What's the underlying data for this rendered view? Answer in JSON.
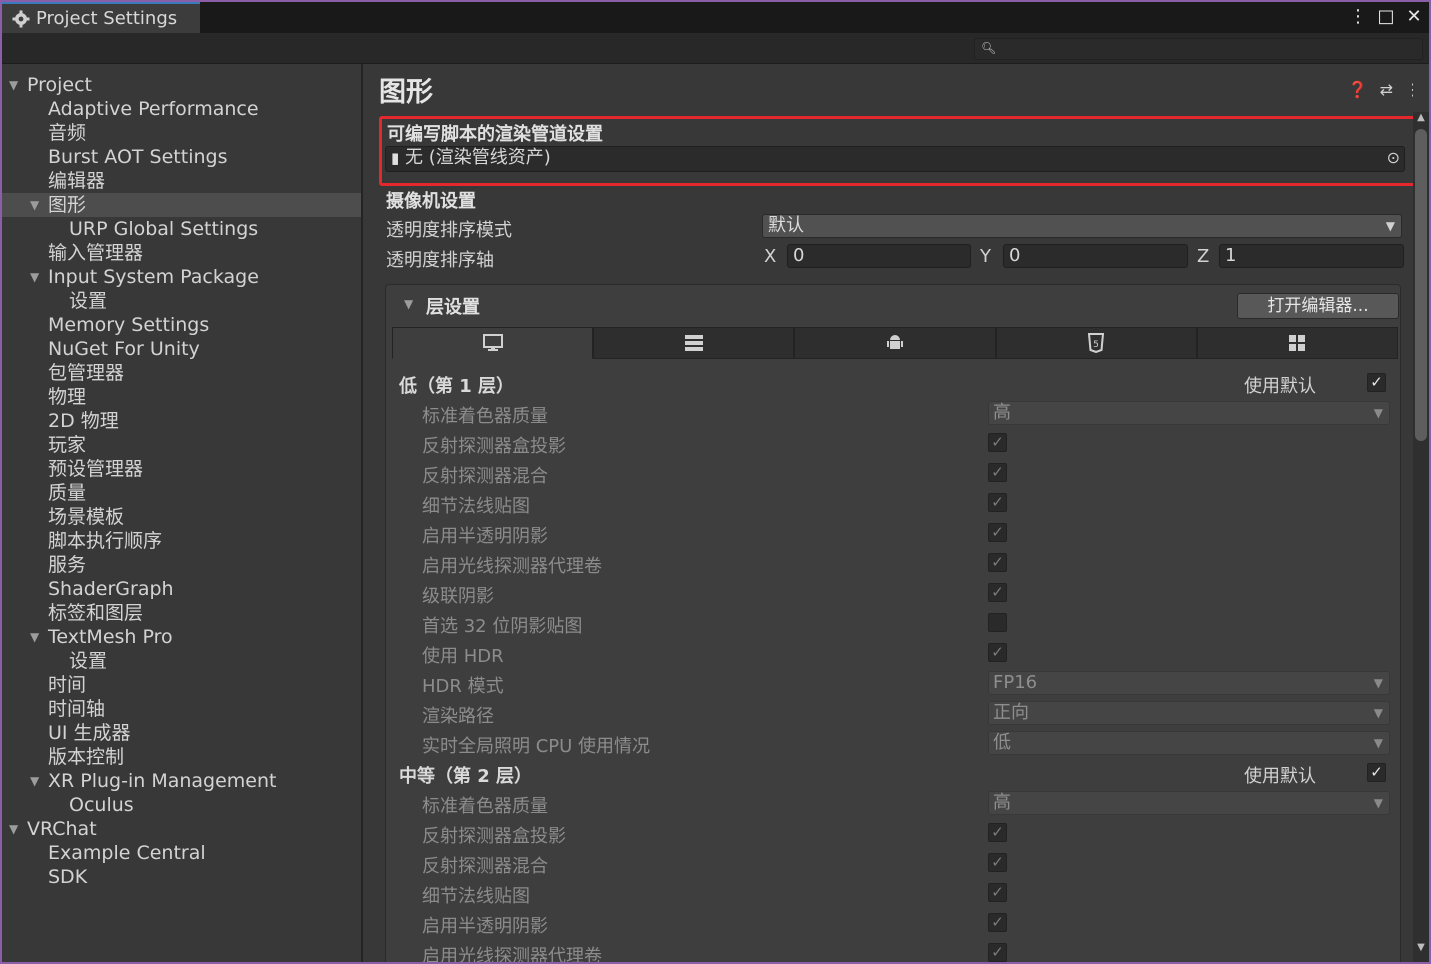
{
  "window": {
    "tab_title": "Project Settings",
    "controls": [
      "⋮",
      "□",
      "✕"
    ]
  },
  "search": {
    "value": ""
  },
  "sidebar": {
    "items": [
      {
        "label": "Project",
        "level": 0,
        "expand": true
      },
      {
        "label": "Adaptive Performance",
        "level": 1
      },
      {
        "label": "音频",
        "level": 1
      },
      {
        "label": "Burst AOT Settings",
        "level": 1
      },
      {
        "label": "编辑器",
        "level": 1
      },
      {
        "label": "图形",
        "level": 1,
        "expand": true,
        "selected": true
      },
      {
        "label": "URP Global Settings",
        "level": 2
      },
      {
        "label": "输入管理器",
        "level": 1
      },
      {
        "label": "Input System Package",
        "level": 1,
        "expand": true
      },
      {
        "label": "设置",
        "level": 2
      },
      {
        "label": "Memory Settings",
        "level": 1
      },
      {
        "label": "NuGet For Unity",
        "level": 1
      },
      {
        "label": "包管理器",
        "level": 1
      },
      {
        "label": "物理",
        "level": 1
      },
      {
        "label": "2D 物理",
        "level": 1
      },
      {
        "label": "玩家",
        "level": 1
      },
      {
        "label": "预设管理器",
        "level": 1
      },
      {
        "label": "质量",
        "level": 1
      },
      {
        "label": "场景模板",
        "level": 1
      },
      {
        "label": "脚本执行顺序",
        "level": 1
      },
      {
        "label": "服务",
        "level": 1
      },
      {
        "label": "ShaderGraph",
        "level": 1
      },
      {
        "label": "标签和图层",
        "level": 1
      },
      {
        "label": "TextMesh Pro",
        "level": 1,
        "expand": true
      },
      {
        "label": "设置",
        "level": 2
      },
      {
        "label": "时间",
        "level": 1
      },
      {
        "label": "时间轴",
        "level": 1
      },
      {
        "label": "UI 生成器",
        "level": 1
      },
      {
        "label": "版本控制",
        "level": 1
      },
      {
        "label": "XR Plug-in Management",
        "level": 1,
        "expand": true
      },
      {
        "label": "Oculus",
        "level": 2
      },
      {
        "label": "VRChat",
        "level": 0,
        "expand": true
      },
      {
        "label": "Example Central",
        "level": 1
      },
      {
        "label": "SDK",
        "level": 1
      }
    ]
  },
  "main": {
    "title": "图形",
    "header_icons": [
      "help-icon",
      "preset-icon",
      "more-icon"
    ],
    "srp": {
      "label": "可编写脚本的渲染管道设置",
      "value": "无 (渲染管线资产)"
    },
    "camera": {
      "section": "摄像机设置",
      "sort_mode_label": "透明度排序模式",
      "sort_mode_value": "默认",
      "sort_axis_label": "透明度排序轴",
      "x_label": "X",
      "x_value": "0",
      "y_label": "Y",
      "y_value": "0",
      "z_label": "Z",
      "z_value": "1"
    },
    "tiers": {
      "section": "层设置",
      "open_editor": "打开编辑器...",
      "platform_tabs": [
        "monitor-icon",
        "server-icon",
        "android-icon",
        "html5-icon",
        "windows-icon"
      ],
      "use_default_label": "使用默认",
      "tier1": {
        "title": "低（第 1 层）",
        "use_default": true,
        "shader_quality_label": "标准着色器质量",
        "shader_quality_value": "高",
        "reflection_box_label": "反射探测器盒投影",
        "reflection_box": true,
        "reflection_blend_label": "反射探测器混合",
        "reflection_blend": true,
        "detail_normal_label": "细节法线贴图",
        "detail_normal": true,
        "semitransparent_label": "启用半透明阴影",
        "semitransparent": true,
        "lppv_label": "启用光线探测器代理卷",
        "lppv": true,
        "cascade_label": "级联阴影",
        "cascade": true,
        "shadow32_label": "首选 32 位阴影贴图",
        "shadow32": false,
        "hdr_label": "使用 HDR",
        "hdr": true,
        "hdr_mode_label": "HDR 模式",
        "hdr_mode_value": "FP16",
        "render_path_label": "渲染路径",
        "render_path_value": "正向",
        "gi_cpu_label": "实时全局照明 CPU 使用情况",
        "gi_cpu_value": "低"
      },
      "tier2": {
        "title": "中等（第 2 层）",
        "use_default": true,
        "shader_quality_label": "标准着色器质量",
        "shader_quality_value": "高",
        "reflection_box_label": "反射探测器盒投影",
        "reflection_box": true,
        "reflection_blend_label": "反射探测器混合",
        "reflection_blend": true,
        "detail_normal_label": "细节法线贴图",
        "detail_normal": true,
        "semitransparent_label": "启用半透明阴影",
        "semitransparent": true,
        "lppv_label": "启用光线探测器代理卷",
        "lppv": true
      }
    }
  },
  "colors": {
    "background": "#383838",
    "highlight": "#e5282e",
    "accent": "#3a79bb"
  }
}
